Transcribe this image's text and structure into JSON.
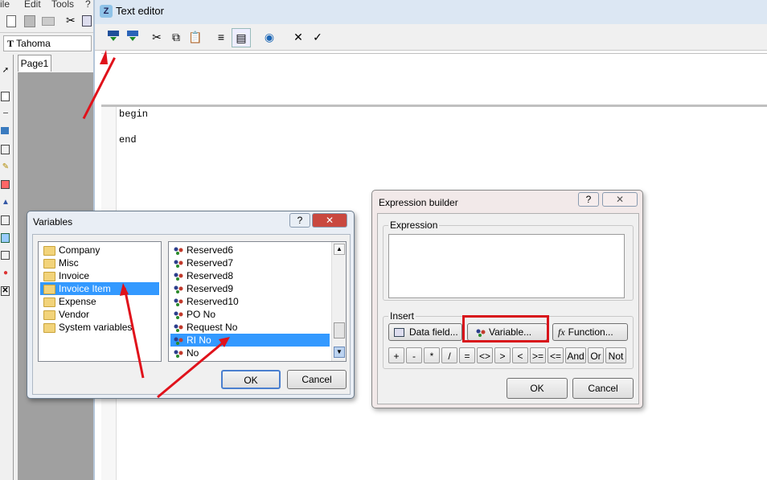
{
  "background_app": {
    "menu": [
      "ile",
      "Edit",
      "Tools",
      "?"
    ],
    "font_name": "Tahoma",
    "page_tab": "Page1"
  },
  "text_editor": {
    "title": "Text editor",
    "code_lines": [
      "begin",
      "end"
    ]
  },
  "variables_dialog": {
    "title": "Variables",
    "help_label": "?",
    "close_label": "✕",
    "folders": [
      "Company",
      "Misc",
      "Invoice",
      "Invoice Item",
      "Expense",
      "Vendor",
      "System variables"
    ],
    "selected_folder": "Invoice Item",
    "variables": [
      "Reserved6",
      "Reserved7",
      "Reserved8",
      "Reserved9",
      "Reserved10",
      "PO No",
      "Request No",
      "RI No",
      "No"
    ],
    "selected_variable": "RI No",
    "ok_label": "OK",
    "cancel_label": "Cancel"
  },
  "expression_builder": {
    "title": "Expression builder",
    "help_label": "?",
    "close_label": "✕",
    "expression_group_label": "Expression",
    "expression_value": "",
    "insert_group_label": "Insert",
    "data_field_label": "Data field...",
    "variable_label": "Variable...",
    "function_label": "Function...",
    "operators": [
      "+",
      "-",
      "*",
      "/",
      "=",
      "<>",
      ">",
      "<",
      ">=",
      "<=",
      "And",
      "Or",
      "Not"
    ],
    "ok_label": "OK",
    "cancel_label": "Cancel"
  },
  "colors": {
    "selection": "#3399ff",
    "annotation_red": "#e0121b"
  }
}
